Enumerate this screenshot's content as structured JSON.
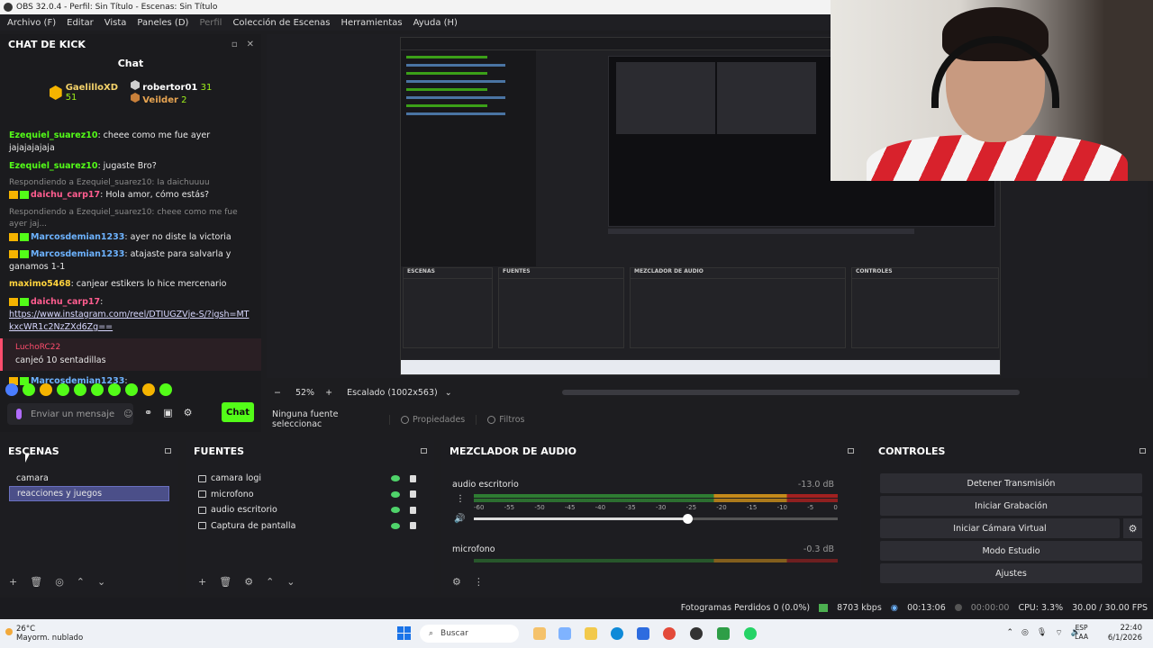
{
  "window": {
    "title": "OBS 32.0.4 - Perfil: Sin Título - Escenas: Sin Título"
  },
  "menu": [
    "Archivo (F)",
    "Editar",
    "Vista",
    "Paneles (D)",
    "Perfil",
    "Colección de Escenas",
    "Herramientas",
    "Ayuda (H)"
  ],
  "chat_dock": {
    "title": "CHAT DE KICK",
    "subtitle": "Chat",
    "leaders": [
      {
        "name": "GaelilloXD",
        "points": "51"
      },
      {
        "name": "robertor01",
        "points": "31"
      },
      {
        "name": "Veilder",
        "points": "2"
      }
    ],
    "messages": [
      {
        "user": "Ezequiel_suarez10",
        "text": ": cheee como me fue ayer jajajajajaja"
      },
      {
        "user": "Ezequiel_suarez10",
        "text": ": jugaste Bro?"
      },
      {
        "reply": "Respondiendo a Ezequiel_suarez10: Ia daichuuuu",
        "user": "daichu_carp17",
        "text": ": Hola amor, cómo estás?"
      },
      {
        "reply": "Respondiendo a Ezequiel_suarez10: cheee como me fue ayer jaj...",
        "user": "Marcosdemian1233",
        "text": ": ayer no diste la victoria"
      },
      {
        "user": "Marcosdemian1233",
        "text": ": atajaste para salvarla y ganamos 1-1"
      },
      {
        "user": "maximo5468",
        "text": ": canjear estikers lo hice mercenario"
      },
      {
        "user": "daichu_carp17",
        "text": ":",
        "link": "https://www.instagram.com/reel/DTIUGZVje-S/?igsh=MTkxcWR1c2NzZXd6Zg=="
      },
      {
        "user": "Marcosdemian1233",
        "text": ":"
      }
    ],
    "redeem": {
      "user": "LuchoRC22",
      "text": "canjeó 10 sentadillas"
    },
    "input_placeholder": "Enviar un mensaje",
    "send_label": "Chat"
  },
  "preview": {
    "zoom": "52%",
    "scale_label": "Escalado (1002x563)",
    "no_source": "Ninguna fuente seleccionac",
    "properties": "Propiedades",
    "filters": "Filtros"
  },
  "scenes": {
    "title": "ESCENAS",
    "items": [
      "camara",
      "reacciones y juegos"
    ],
    "selected": "reacciones y juegos"
  },
  "sources": {
    "title": "FUENTES",
    "items": [
      "camara logi",
      "microfono",
      "audio escritorio",
      "Captura de pantalla"
    ]
  },
  "mixer": {
    "title": "MEZCLADOR DE AUDIO",
    "channels": [
      {
        "name": "audio escritorio",
        "db": "-13.0 dB",
        "volume": 0.59
      },
      {
        "name": "microfono",
        "db": "-0.3 dB"
      }
    ],
    "ticks": [
      "-60",
      "-55",
      "-50",
      "-45",
      "-40",
      "-35",
      "-30",
      "-25",
      "-20",
      "-15",
      "-10",
      "-5",
      "0"
    ]
  },
  "controls": {
    "title": "CONTROLES",
    "buttons": [
      "Detener Transmisión",
      "Iniciar Grabación",
      "Iniciar Cámara Virtual",
      "Modo Estudio",
      "Ajustes"
    ]
  },
  "status": {
    "dropped": "Fotogramas Perdidos 0 (0.0%)",
    "bitrate": "8703 kbps",
    "stream_time": "00:13:06",
    "rec_time": "00:00:00",
    "cpu": "CPU: 3.3%",
    "fps": "30.00 / 30.00 FPS"
  },
  "taskbar": {
    "temp": "26°C",
    "weather": "Mayorm. nublado",
    "search": "Buscar",
    "lang1": "ESP",
    "lang2": "LAA",
    "time": "22:40",
    "date": "6/1/2026"
  },
  "colors": {
    "kick_green": "#53fc18",
    "selected_scene": "#4b4f89"
  }
}
